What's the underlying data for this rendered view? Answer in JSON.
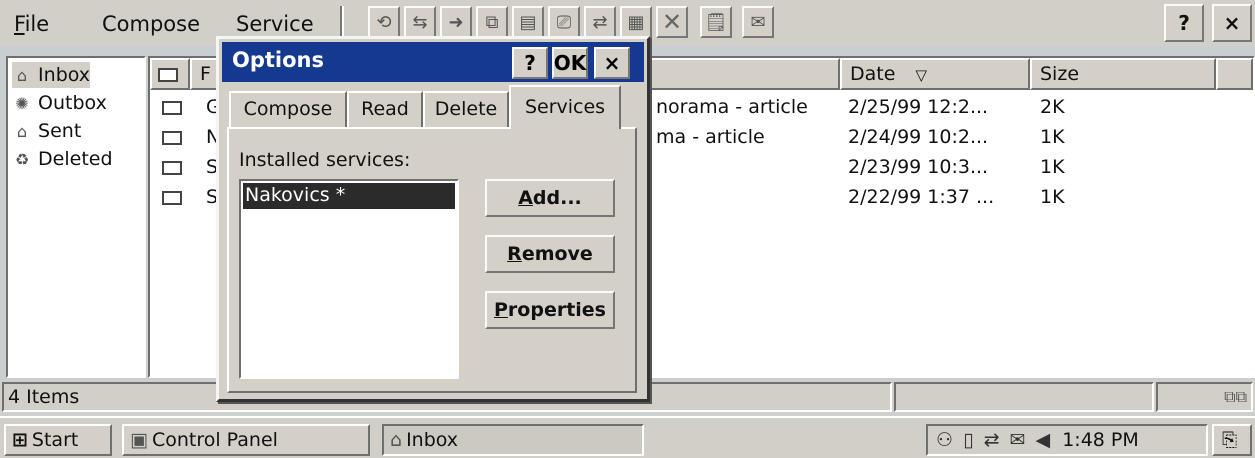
{
  "menubar": {
    "file": "File",
    "compose": "Compose",
    "service": "Service",
    "help": "?",
    "close": "×"
  },
  "folders": [
    {
      "label": "Inbox",
      "icon": "inbox-icon"
    },
    {
      "label": "Outbox",
      "icon": "outbox-icon"
    },
    {
      "label": "Sent",
      "icon": "sent-icon"
    },
    {
      "label": "Deleted",
      "icon": "deleted-icon"
    }
  ],
  "list": {
    "headers": {
      "from": "F",
      "date": "Date",
      "size": "Size"
    },
    "date_sort_glyph": "▽",
    "rows": [
      {
        "from": "G",
        "subject": "norama - article",
        "date": "2/25/99 12:2...",
        "size": "2K"
      },
      {
        "from": "N",
        "subject": "ma - article",
        "date": "2/24/99 10:2...",
        "size": "1K"
      },
      {
        "from": "S",
        "subject": "",
        "date": "2/23/99 10:3...",
        "size": "1K"
      },
      {
        "from": "S",
        "subject": "",
        "date": "2/22/99 1:37 ...",
        "size": "1K"
      }
    ]
  },
  "status": {
    "items": "4 Items"
  },
  "taskbar": {
    "start": "Start",
    "control_panel": "Control Panel",
    "inbox": "Inbox",
    "clock": "1:48 PM"
  },
  "dialog": {
    "title": "Options",
    "help": "?",
    "ok": "OK",
    "close": "×",
    "tabs": [
      "Compose",
      "Read",
      "Delete",
      "Services"
    ],
    "installed_label": "Installed services:",
    "services": [
      "Nakovics *"
    ],
    "add": "Add...",
    "remove": "Remove",
    "properties": "Properties"
  }
}
